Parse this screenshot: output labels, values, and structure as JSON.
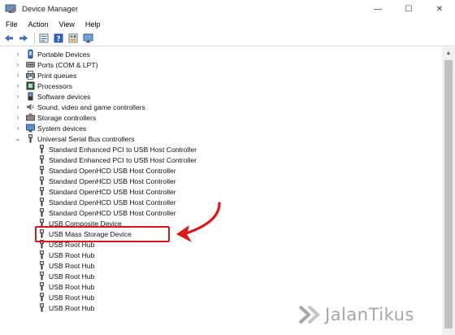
{
  "window": {
    "title": "Device Manager",
    "minimize": "—",
    "maximize": "☐",
    "close": "✕"
  },
  "menu": [
    "File",
    "Action",
    "View",
    "Help"
  ],
  "toolbar": [
    "back-icon",
    "forward-icon",
    "properties-icon",
    "help-icon",
    "view-icon",
    "monitor-icon"
  ],
  "tree": {
    "categories": [
      {
        "label": "Portable Devices",
        "icon": "portable-device-icon"
      },
      {
        "label": "Ports (COM & LPT)",
        "icon": "port-icon"
      },
      {
        "label": "Print queues",
        "icon": "printer-icon"
      },
      {
        "label": "Processors",
        "icon": "processor-icon"
      },
      {
        "label": "Software devices",
        "icon": "software-device-icon"
      },
      {
        "label": "Sound, video and game controllers",
        "icon": "sound-icon"
      },
      {
        "label": "Storage controllers",
        "icon": "storage-controller-icon"
      },
      {
        "label": "System devices",
        "icon": "system-device-icon"
      }
    ],
    "usb_category": {
      "label": "Universal Serial Bus controllers",
      "icon": "usb-icon",
      "expanded": true
    },
    "usb_devices": [
      "Standard Enhanced PCI to USB Host Controller",
      "Standard Enhanced PCI to USB Host Controller",
      "Standard OpenHCD USB Host Controller",
      "Standard OpenHCD USB Host Controller",
      "Standard OpenHCD USB Host Controller",
      "Standard OpenHCD USB Host Controller",
      "Standard OpenHCD USB Host Controller",
      "USB Composite Device",
      "USB Mass Storage Device",
      "USB Root Hub",
      "USB Root Hub",
      "USB Root Hub",
      "USB Root Hub",
      "USB Root Hub",
      "USB Root Hub",
      "USB Root Hub"
    ],
    "highlighted_device": "USB Mass Storage Device"
  },
  "annotation": {
    "color": "#e0151b"
  },
  "watermark": {
    "text": "JalanTikus"
  }
}
